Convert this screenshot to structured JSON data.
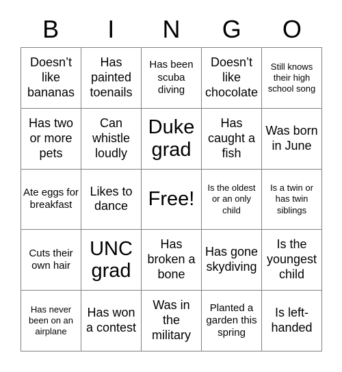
{
  "card": {
    "title": "BINGO",
    "background_color": "#ffffff",
    "text_color": "#000000",
    "border_color": "#808080"
  },
  "header": {
    "letters": [
      {
        "label": "B"
      },
      {
        "label": "I"
      },
      {
        "label": "N"
      },
      {
        "label": "G"
      },
      {
        "label": "O"
      }
    ]
  },
  "grid": {
    "columns": 5,
    "rows": 5,
    "free_space_index": 12,
    "cells": [
      {
        "text": "Doesn’t like bananas",
        "size": "md"
      },
      {
        "text": "Has painted toenails",
        "size": "md"
      },
      {
        "text": "Has been scuba diving",
        "size": "sm"
      },
      {
        "text": "Doesn’t like chocolate",
        "size": "md"
      },
      {
        "text": "Still knows their high school song",
        "size": "xs"
      },
      {
        "text": "Has two or more pets",
        "size": "md"
      },
      {
        "text": "Can whistle loudly",
        "size": "md"
      },
      {
        "text": "Duke grad",
        "size": "xl"
      },
      {
        "text": "Has caught a fish",
        "size": "md"
      },
      {
        "text": "Was born in June",
        "size": "md"
      },
      {
        "text": "Ate eggs for breakfast",
        "size": "sm"
      },
      {
        "text": "Likes to dance",
        "size": "md"
      },
      {
        "text": "Free!",
        "size": "xl"
      },
      {
        "text": "Is the oldest or an only child",
        "size": "xs"
      },
      {
        "text": "Is a twin or has twin siblings",
        "size": "xs"
      },
      {
        "text": "Cuts their own hair",
        "size": "sm"
      },
      {
        "text": "UNC grad",
        "size": "xl"
      },
      {
        "text": "Has broken a bone",
        "size": "md"
      },
      {
        "text": "Has gone skydiving",
        "size": "md"
      },
      {
        "text": "Is the youngest child",
        "size": "md"
      },
      {
        "text": "Has never been on an airplane",
        "size": "xs"
      },
      {
        "text": "Has won a contest",
        "size": "md"
      },
      {
        "text": "Was in the military",
        "size": "md"
      },
      {
        "text": "Planted a garden this spring",
        "size": "sm"
      },
      {
        "text": "Is left-handed",
        "size": "md"
      }
    ]
  }
}
